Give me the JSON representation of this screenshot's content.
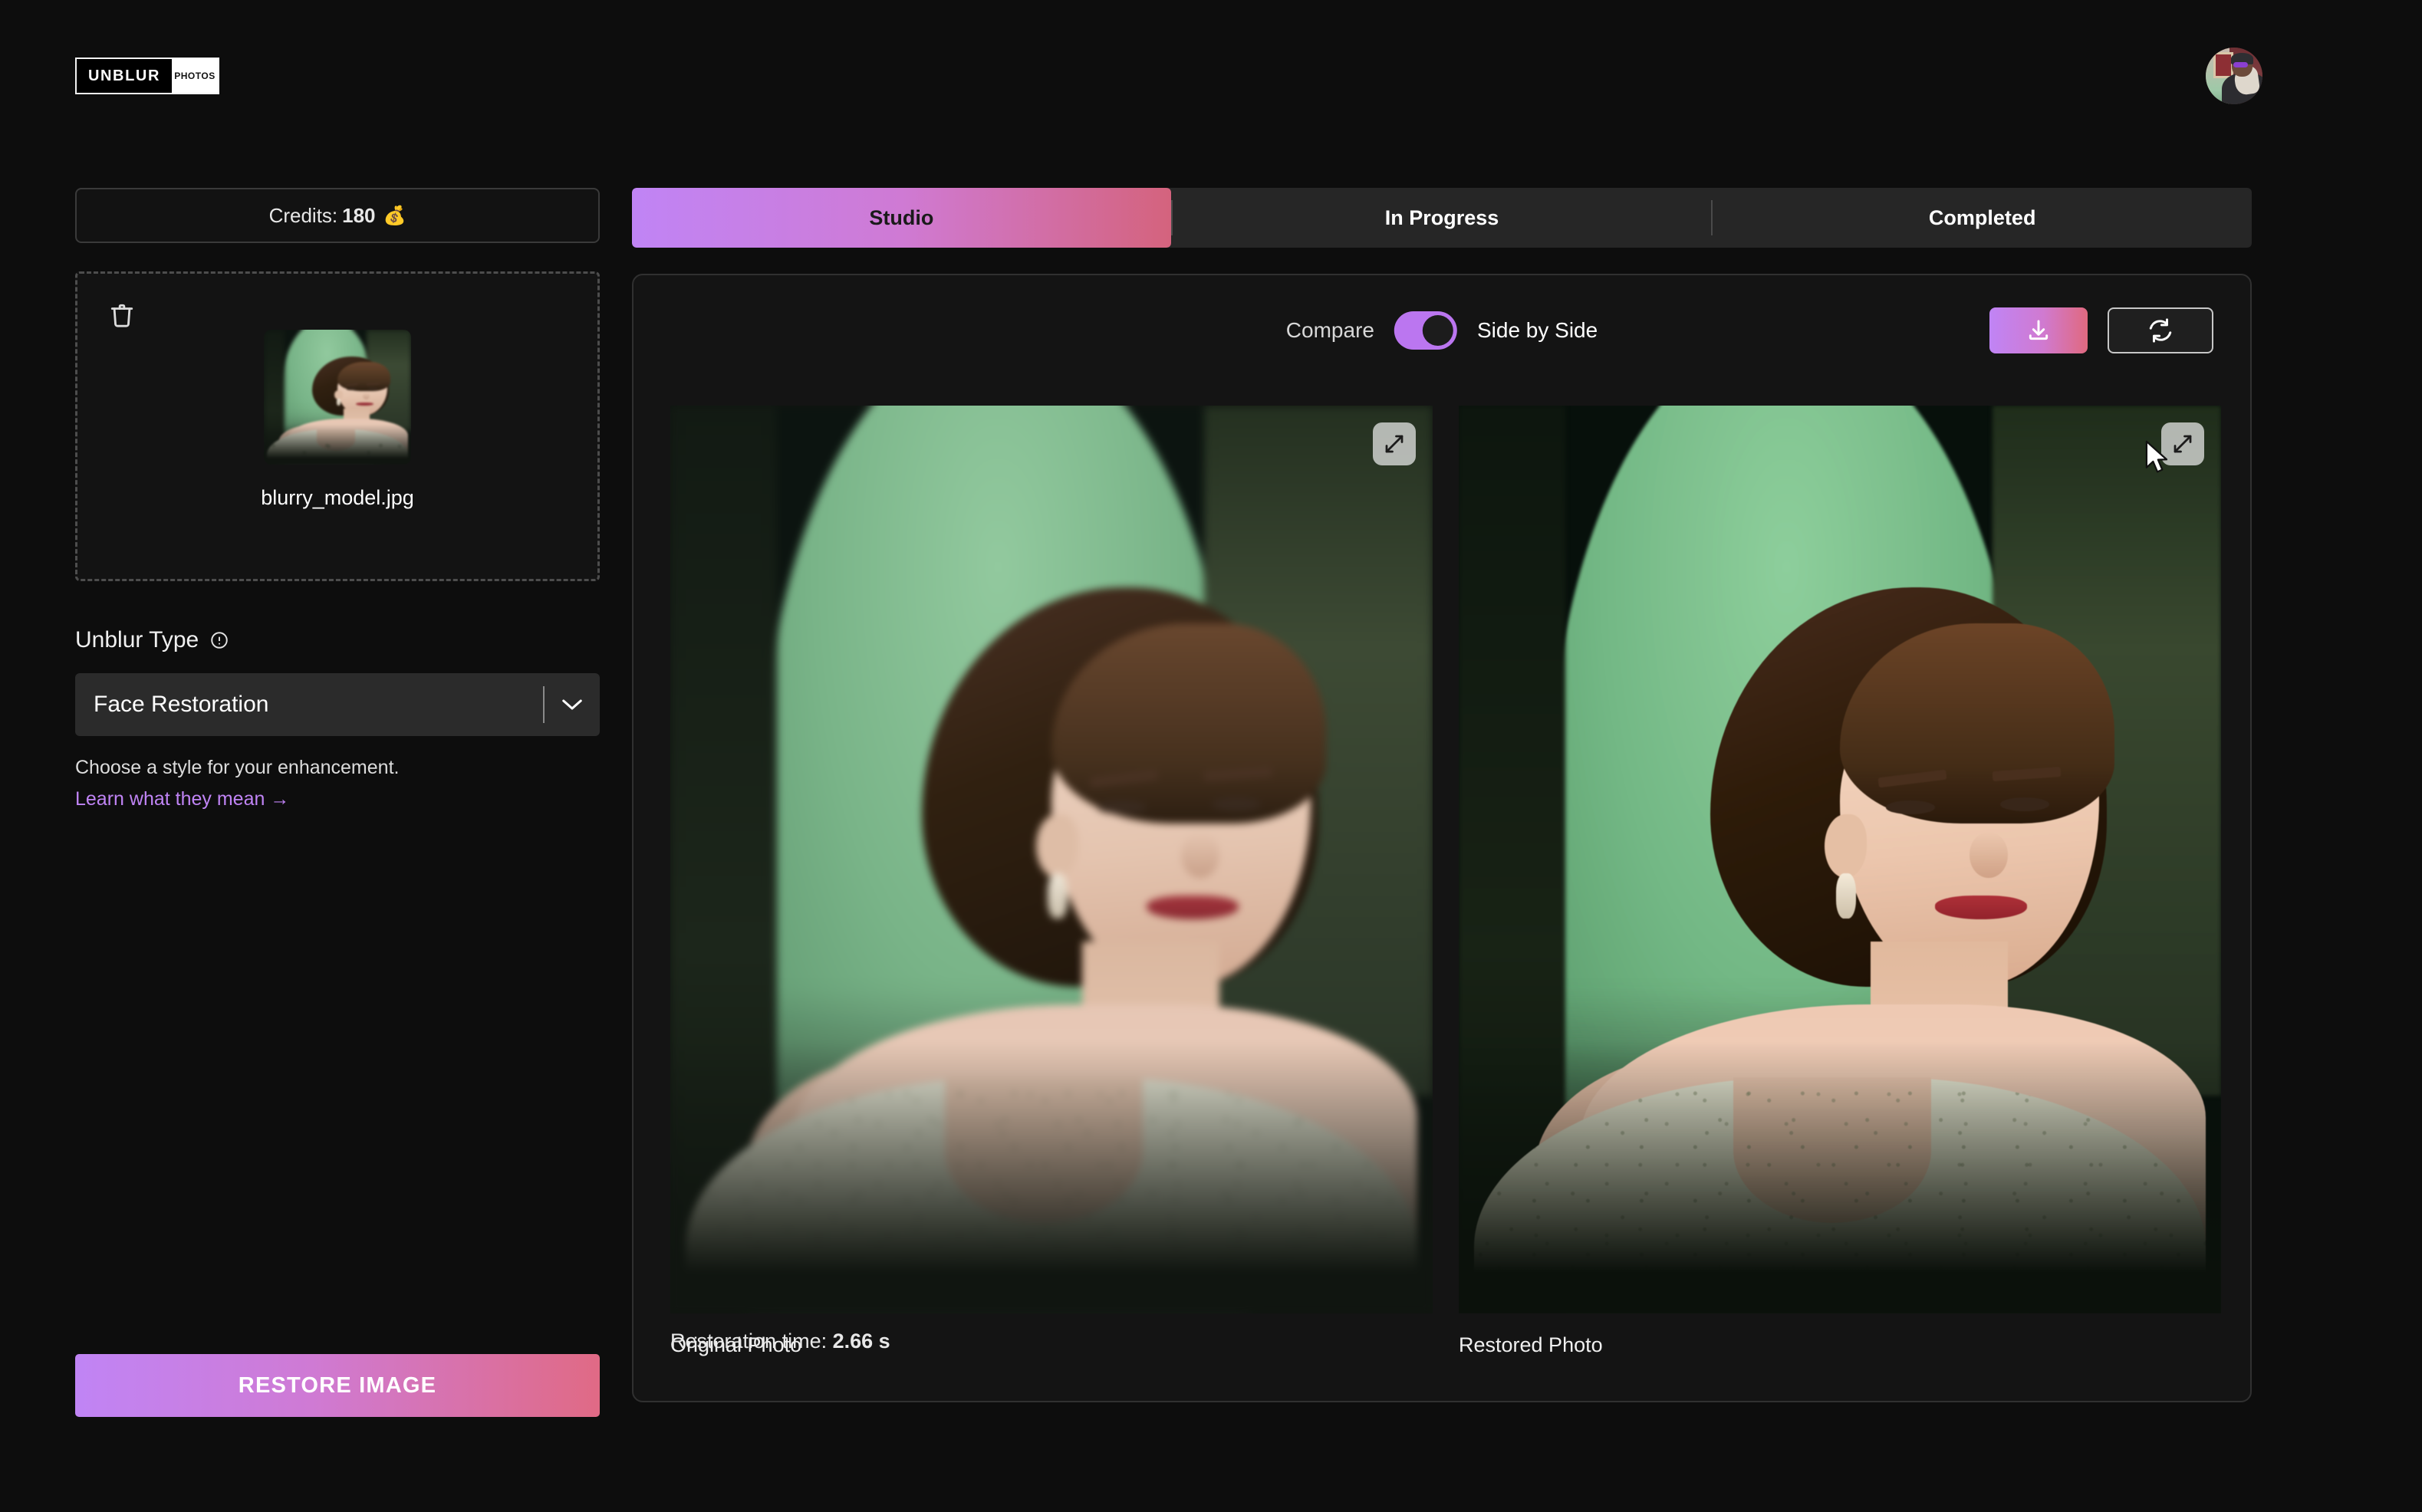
{
  "header": {
    "logo_primary": "UNBLUR",
    "logo_secondary": "PHOTOS",
    "avatar_name": "user-avatar"
  },
  "sidebar": {
    "credits_label": "Credits:",
    "credits_value": "180",
    "credits_emoji": "💰",
    "dropzone": {
      "delete_icon": "trash-icon",
      "file_name": "blurry_model.jpg"
    },
    "unblur_type": {
      "label": "Unblur Type",
      "info_icon": "info-icon",
      "selected": "Face Restoration",
      "chevron_icon": "chevron-down-icon",
      "hint": "Choose a style for your enhancement.",
      "link": "Learn what they mean →"
    },
    "restore_button": "RESTORE IMAGE"
  },
  "main": {
    "tabs": [
      {
        "label": "Studio",
        "active": true
      },
      {
        "label": "In Progress",
        "active": false
      },
      {
        "label": "Completed",
        "active": false
      }
    ],
    "compare": {
      "label": "Compare",
      "toggle_state": "on",
      "mode_label": "Side by Side"
    },
    "actions": {
      "download_icon": "download-icon",
      "reset_icon": "refresh-icon"
    },
    "images": [
      {
        "caption": "Original Photo",
        "expand_icon": "expand-icon",
        "variant": "blurred"
      },
      {
        "caption": "Restored Photo",
        "expand_icon": "expand-icon",
        "variant": "sharp"
      }
    ],
    "restoration_time_label": "Restoration time:",
    "restoration_time_value": "2.66 s"
  },
  "colors": {
    "accent_purple": "#c084f5",
    "accent_pink": "#d4637d",
    "background": "#0d0d0d",
    "panel": "#141414",
    "tabbar": "#262626"
  }
}
